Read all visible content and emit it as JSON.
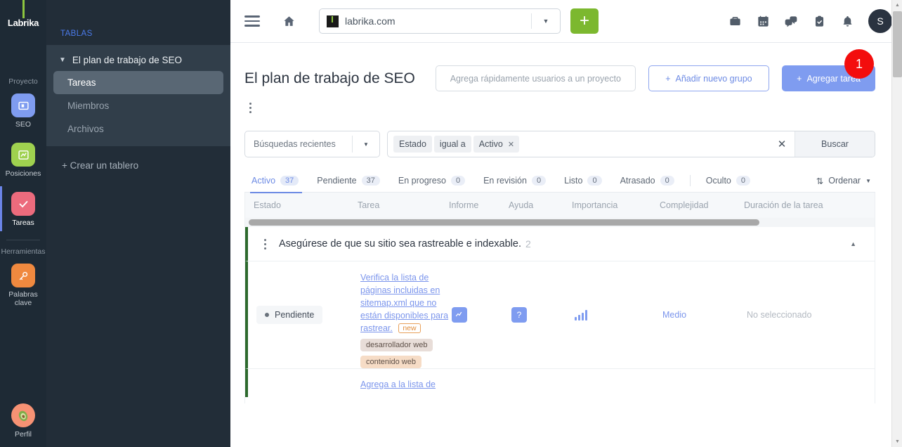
{
  "rail": {
    "logo": "Labrika",
    "section_project": "Proyecto",
    "section_tools": "Herramientas",
    "items": [
      {
        "label": "SEO",
        "icon": "seo-icon"
      },
      {
        "label": "Posiciones",
        "icon": "chart-icon"
      },
      {
        "label": "Tareas",
        "icon": "check-icon"
      },
      {
        "label": "Palabras clave",
        "icon": "key-icon"
      }
    ],
    "profile": "Perfil"
  },
  "sidebar": {
    "title": "TABLAS",
    "group_label": "El plan de trabajo de SEO",
    "items": [
      {
        "label": "Tareas"
      },
      {
        "label": "Miembros"
      },
      {
        "label": "Archivos"
      }
    ],
    "create_board": "+ Crear un tablero"
  },
  "topbar": {
    "url_value": "labrika.com",
    "url_placeholder": "labrika.com",
    "add_label": "+",
    "avatar_initial": "S",
    "icons": [
      "briefcase-icon",
      "calendar-icon",
      "chat-icon",
      "clipboard-check-icon",
      "bell-icon"
    ]
  },
  "header": {
    "title": "El plan de trabajo de SEO",
    "add_users_label": "Agrega rápidamente usuarios a un proyecto",
    "add_group_label": "Añadir nuevo grupo",
    "add_task_label": "Agregar tarea",
    "step_badge": "1"
  },
  "search": {
    "recent_label": "Búsquedas recientes",
    "filter_field": "Estado",
    "filter_operator": "igual a",
    "filter_value": "Activo",
    "search_button": "Buscar"
  },
  "tabs": [
    {
      "label": "Activo",
      "count": "37",
      "active": true
    },
    {
      "label": "Pendiente",
      "count": "37",
      "active": false
    },
    {
      "label": "En progreso",
      "count": "0",
      "active": false
    },
    {
      "label": "En revisión",
      "count": "0",
      "active": false
    },
    {
      "label": "Listo",
      "count": "0",
      "active": false
    },
    {
      "label": "Atrasado",
      "count": "0",
      "active": false
    },
    {
      "label": "Oculto",
      "count": "0",
      "active": false
    }
  ],
  "sort_label": "Ordenar",
  "table": {
    "columns": {
      "estado": "Estado",
      "tarea": "Tarea",
      "informe": "Informe",
      "ayuda": "Ayuda",
      "importancia": "Importancia",
      "complejidad": "Complejidad",
      "duracion": "Duración de la tarea"
    },
    "group": {
      "title": "Asegúrese de que su sitio sea rastreable e indexable.",
      "count": "2"
    },
    "rows": [
      {
        "status": "Pendiente",
        "task": "Verifica la lista de páginas incluidas en sitemap.xml que no están disponibles para rastrear.",
        "new_tag": "new",
        "tags": [
          "desarrollador web",
          "contenido web"
        ],
        "informe_icon": "trend-icon",
        "ayuda_icon": "question-icon",
        "importancia": "bar-chart-icon",
        "complejidad": "Medio",
        "duracion": "No seleccionado"
      },
      {
        "task": "Agrega a la lista de"
      }
    ]
  },
  "colors": {
    "accent_blue": "#7f9cf0",
    "green": "#7cb82f",
    "badge_red": "#f30d0d",
    "rail_bg": "#1e2a35",
    "sidebar_bg": "#222d38"
  }
}
